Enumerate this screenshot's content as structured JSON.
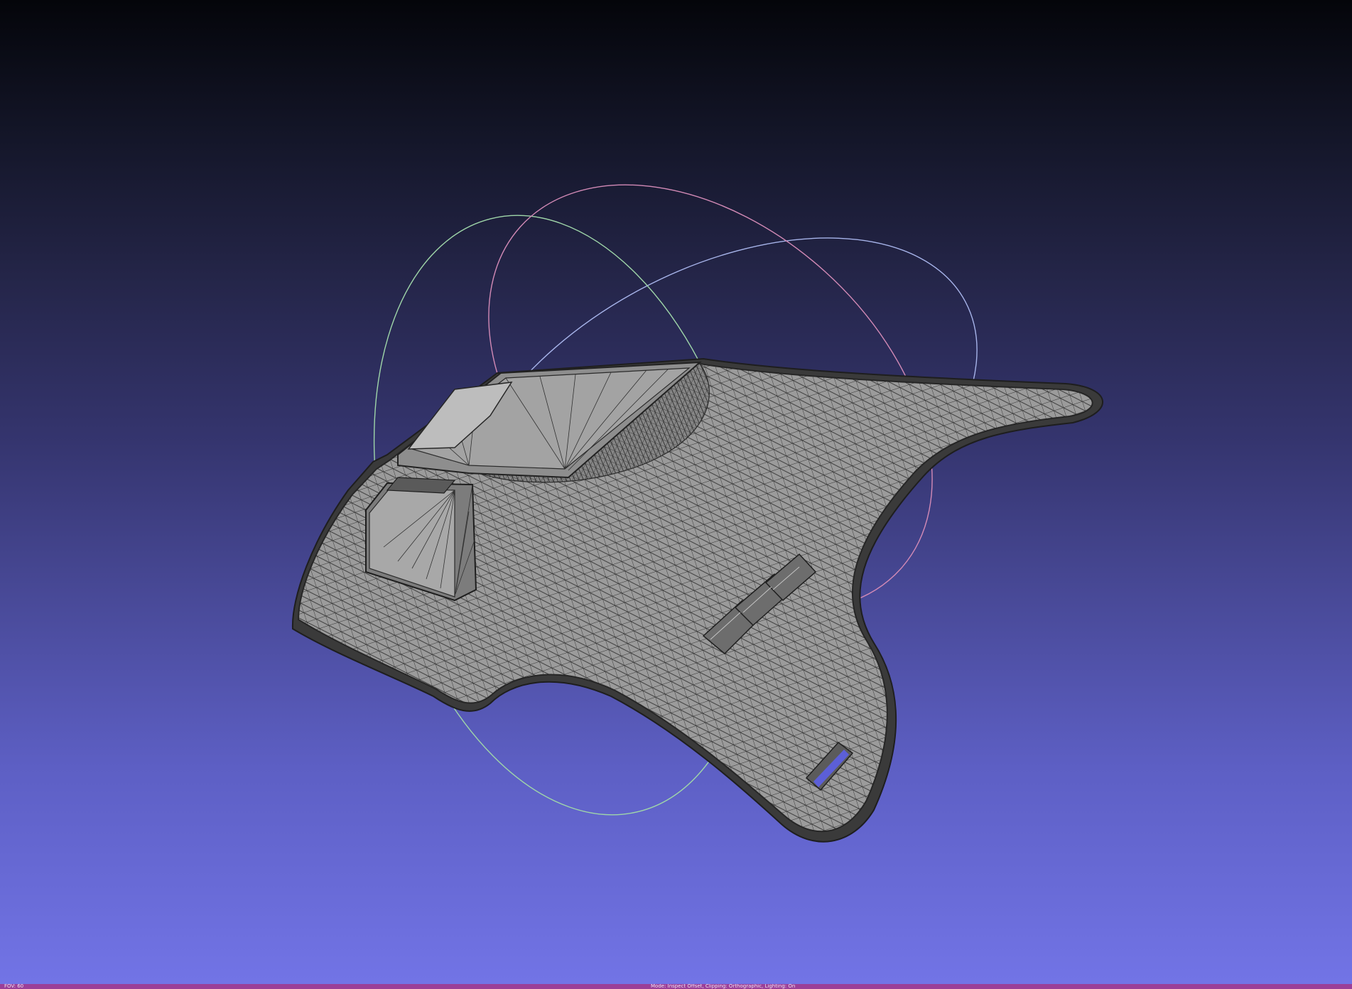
{
  "viewer": {
    "fov_label": "FOV: 60",
    "mode_label": "Mode: Inspect Offset, Clipping: Orthographic, Lighting: On"
  },
  "colors": {
    "background_top": "#04050a",
    "background_bottom": "#7274e6",
    "mesh_fill": "#9c9c9c",
    "wire": "#2e2e2e",
    "status_bar": "#9b3f98",
    "trackball_red": "#d28ab6",
    "trackball_green": "#9fd6a9",
    "trackball_blue": "#a7b4ea"
  },
  "icons": {
    "trackball": "trackball-gizmo-icon"
  }
}
